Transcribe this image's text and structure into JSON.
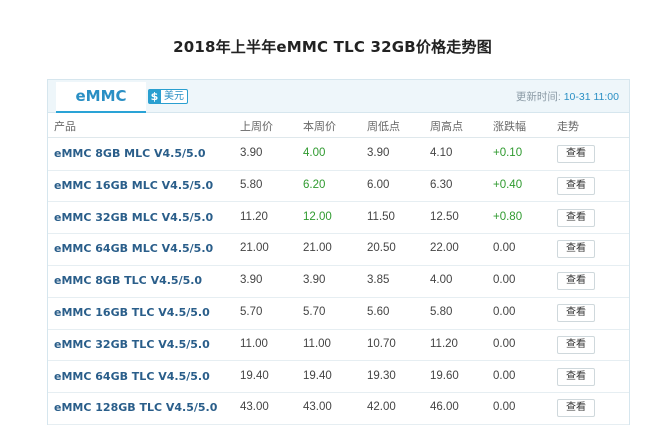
{
  "title": "2018年上半年eMMC TLC 32GB价格走势图",
  "tabs": {
    "active": "eMMC",
    "currency_symbol": "$",
    "currency_label": "美元"
  },
  "update": {
    "label": "更新时间:",
    "time": "10-31 11:00"
  },
  "columns": [
    "产品",
    "上周价",
    "本周价",
    "周低点",
    "周高点",
    "涨跌幅",
    "走势"
  ],
  "rows": [
    {
      "name": "eMMC 8GB MLC V4.5/5.0",
      "last": "3.90",
      "current": "4.00",
      "low": "3.90",
      "high": "4.10",
      "change": "+0.10",
      "action": "查看"
    },
    {
      "name": "eMMC 16GB MLC V4.5/5.0",
      "last": "5.80",
      "current": "6.20",
      "low": "6.00",
      "high": "6.30",
      "change": "+0.40",
      "action": "查看"
    },
    {
      "name": "eMMC 32GB MLC V4.5/5.0",
      "last": "11.20",
      "current": "12.00",
      "low": "11.50",
      "high": "12.50",
      "change": "+0.80",
      "action": "查看"
    },
    {
      "name": "eMMC 64GB MLC V4.5/5.0",
      "last": "21.00",
      "current": "21.00",
      "low": "20.50",
      "high": "22.00",
      "change": "0.00",
      "action": "查看"
    },
    {
      "name": "eMMC 8GB TLC V4.5/5.0",
      "last": "3.90",
      "current": "3.90",
      "low": "3.85",
      "high": "4.00",
      "change": "0.00",
      "action": "查看"
    },
    {
      "name": "eMMC 16GB TLC V4.5/5.0",
      "last": "5.70",
      "current": "5.70",
      "low": "5.60",
      "high": "5.80",
      "change": "0.00",
      "action": "查看"
    },
    {
      "name": "eMMC 32GB TLC V4.5/5.0",
      "last": "11.00",
      "current": "11.00",
      "low": "10.70",
      "high": "11.20",
      "change": "0.00",
      "action": "查看"
    },
    {
      "name": "eMMC 64GB TLC V4.5/5.0",
      "last": "19.40",
      "current": "19.40",
      "low": "19.30",
      "high": "19.60",
      "change": "0.00",
      "action": "查看"
    },
    {
      "name": "eMMC 128GB TLC V4.5/5.0",
      "last": "43.00",
      "current": "43.00",
      "low": "42.00",
      "high": "46.00",
      "change": "0.00",
      "action": "查看"
    }
  ],
  "colors": {
    "accent": "#2a8fc4",
    "up": "#2f9a2f",
    "product": "#2a5e8a"
  }
}
